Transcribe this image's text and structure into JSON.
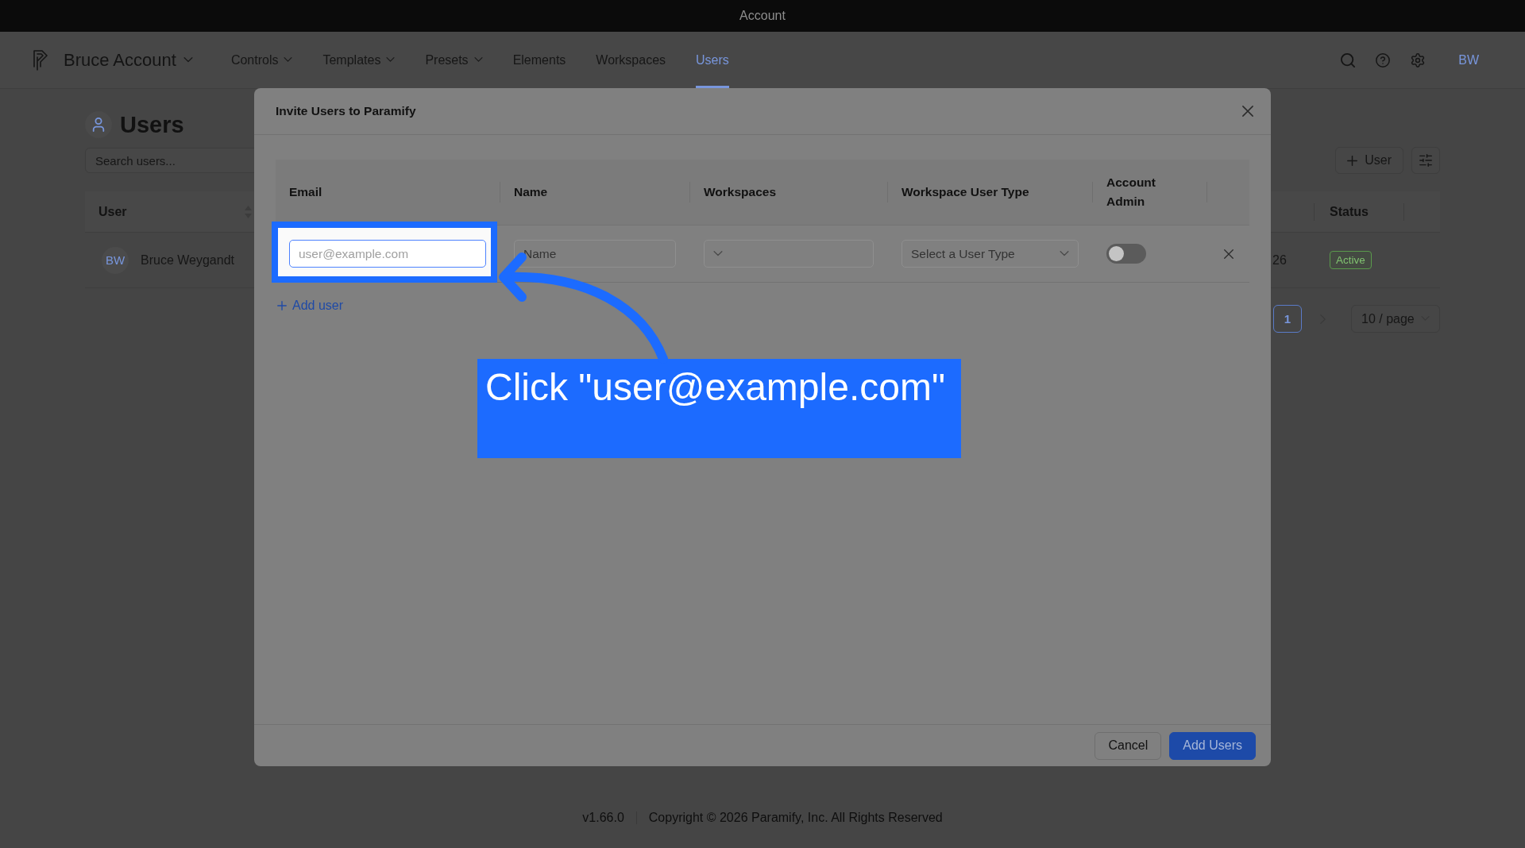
{
  "window": {
    "title": "Account"
  },
  "navbar": {
    "account": "Bruce Account",
    "items": [
      {
        "label": "Controls",
        "dropdown": true,
        "selected": false
      },
      {
        "label": "Templates",
        "dropdown": true,
        "selected": false
      },
      {
        "label": "Presets",
        "dropdown": true,
        "selected": false
      },
      {
        "label": "Elements",
        "dropdown": false,
        "selected": false
      },
      {
        "label": "Workspaces",
        "dropdown": false,
        "selected": false
      },
      {
        "label": "Users",
        "dropdown": false,
        "selected": true
      }
    ],
    "avatar": "BW"
  },
  "page": {
    "title": "Users",
    "search": {
      "placeholder": "Search users..."
    },
    "add_button": "User",
    "table": {
      "columns": [
        {
          "label": "User",
          "sortable": true
        },
        {
          "label": "Status",
          "sortable": false
        }
      ],
      "rows": [
        {
          "initials": "BW",
          "name": "Bruce Weygandt",
          "column_3": "26",
          "status": "Active"
        }
      ]
    },
    "pagination": {
      "pages": [
        {
          "label": "1",
          "selected": true
        }
      ],
      "page_size": "10 / page"
    }
  },
  "modal": {
    "title": "Invite Users to Paramify",
    "columns": [
      "Email",
      "Name",
      "Workspaces",
      "Workspace User Type",
      "Account Admin"
    ],
    "rows": [
      {
        "cells": [
          {
            "kind": "input",
            "placeholder": "user@example.com",
            "highlighted": true
          },
          {
            "kind": "input",
            "placeholder": "Name",
            "highlighted": false
          },
          {
            "kind": "select"
          },
          {
            "kind": "select",
            "placeholder": "Select a User Type"
          },
          {
            "kind": "toggle",
            "on": false
          },
          {
            "kind": "remove"
          }
        ]
      }
    ],
    "add_row": "Add user",
    "buttons": [
      {
        "label": "Cancel",
        "kind": "secondary"
      },
      {
        "label": "Add Users",
        "kind": "primary"
      }
    ]
  },
  "callout": {
    "text": "Click \"user@example.com\""
  },
  "footer": {
    "version": "v1.66.0",
    "copyright": "Copyright © 2026 Paramify, Inc. All Rights Reserved"
  }
}
